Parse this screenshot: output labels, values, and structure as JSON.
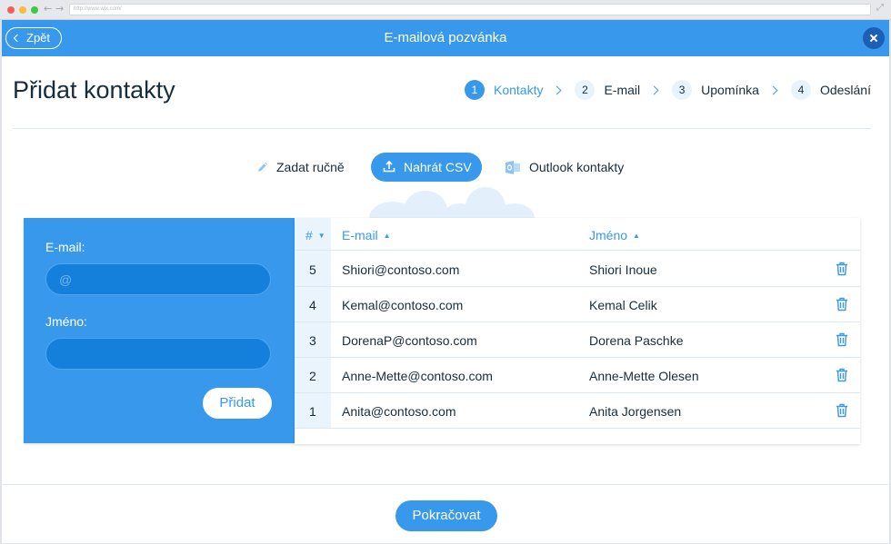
{
  "browser": {
    "url": "http://www.wix.com/",
    "back_arrow": "←",
    "forward_arrow": "→",
    "expand_icon": "⤢"
  },
  "header": {
    "back_label": "Zpět",
    "title": "E-mailová pozvánka"
  },
  "page": {
    "title": "Přidat kontakty"
  },
  "steps": [
    {
      "num": "1",
      "label": "Kontakty",
      "active": true
    },
    {
      "num": "2",
      "label": "E-mail",
      "active": false
    },
    {
      "num": "3",
      "label": "Upomínka",
      "active": false
    },
    {
      "num": "4",
      "label": "Odeslání",
      "active": false
    }
  ],
  "methods": {
    "manual": "Zadat ručně",
    "csv": "Nahrát CSV",
    "outlook": "Outlook kontakty"
  },
  "form": {
    "email_label": "E-mail:",
    "email_placeholder": "@",
    "email_value": "",
    "name_label": "Jméno:",
    "name_value": "",
    "add_button": "Přidat"
  },
  "table": {
    "columns": {
      "num": "#",
      "email": "E-mail",
      "name": "Jméno"
    },
    "sort_arrows": {
      "num": "▼",
      "email": "▲",
      "name": "▲"
    },
    "rows": [
      {
        "num": "5",
        "email": "Shiori@contoso.com",
        "name": "Shiori Inoue"
      },
      {
        "num": "4",
        "email": "Kemal@contoso.com",
        "name": "Kemal Celik"
      },
      {
        "num": "3",
        "email": "DorenaP@contoso.com",
        "name": "Dorena Paschke"
      },
      {
        "num": "2",
        "email": "Anne-Mette@contoso.com",
        "name": "Anne-Mette Olesen"
      },
      {
        "num": "1",
        "email": "Anita@contoso.com",
        "name": "Anita Jorgensen"
      }
    ]
  },
  "footer": {
    "continue_button": "Pokračovat"
  },
  "colors": {
    "accent": "#3899ec",
    "accent_dark": "#1580dc",
    "text": "#162d3d",
    "light_blue": "#eaf4fd"
  }
}
